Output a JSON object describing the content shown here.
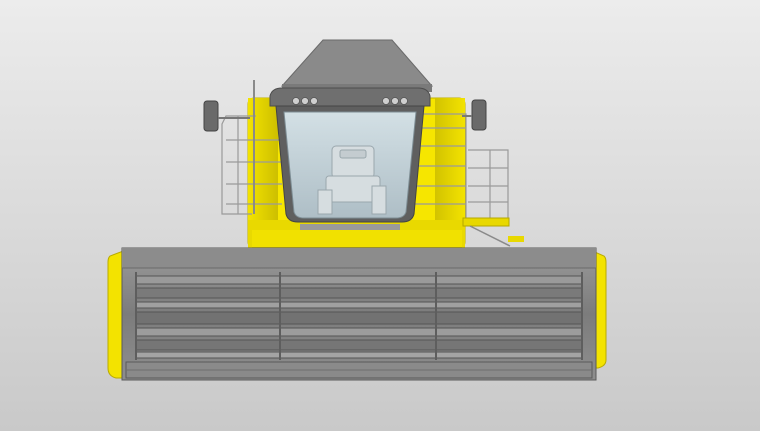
{
  "viewport": {
    "background_top": "#ececec",
    "background_bottom": "#c9c9c9"
  },
  "model": {
    "subject": "combine-harvester-front-view",
    "colors": {
      "body_yellow": "#f6e600",
      "body_yellow_dark": "#c9ba00",
      "header_gray": "#7f7f7f",
      "header_gray_dark": "#555555",
      "roof_gray": "#8a8a8a",
      "glass": "#bfcfd6",
      "rail": "#9a9a9a"
    }
  }
}
